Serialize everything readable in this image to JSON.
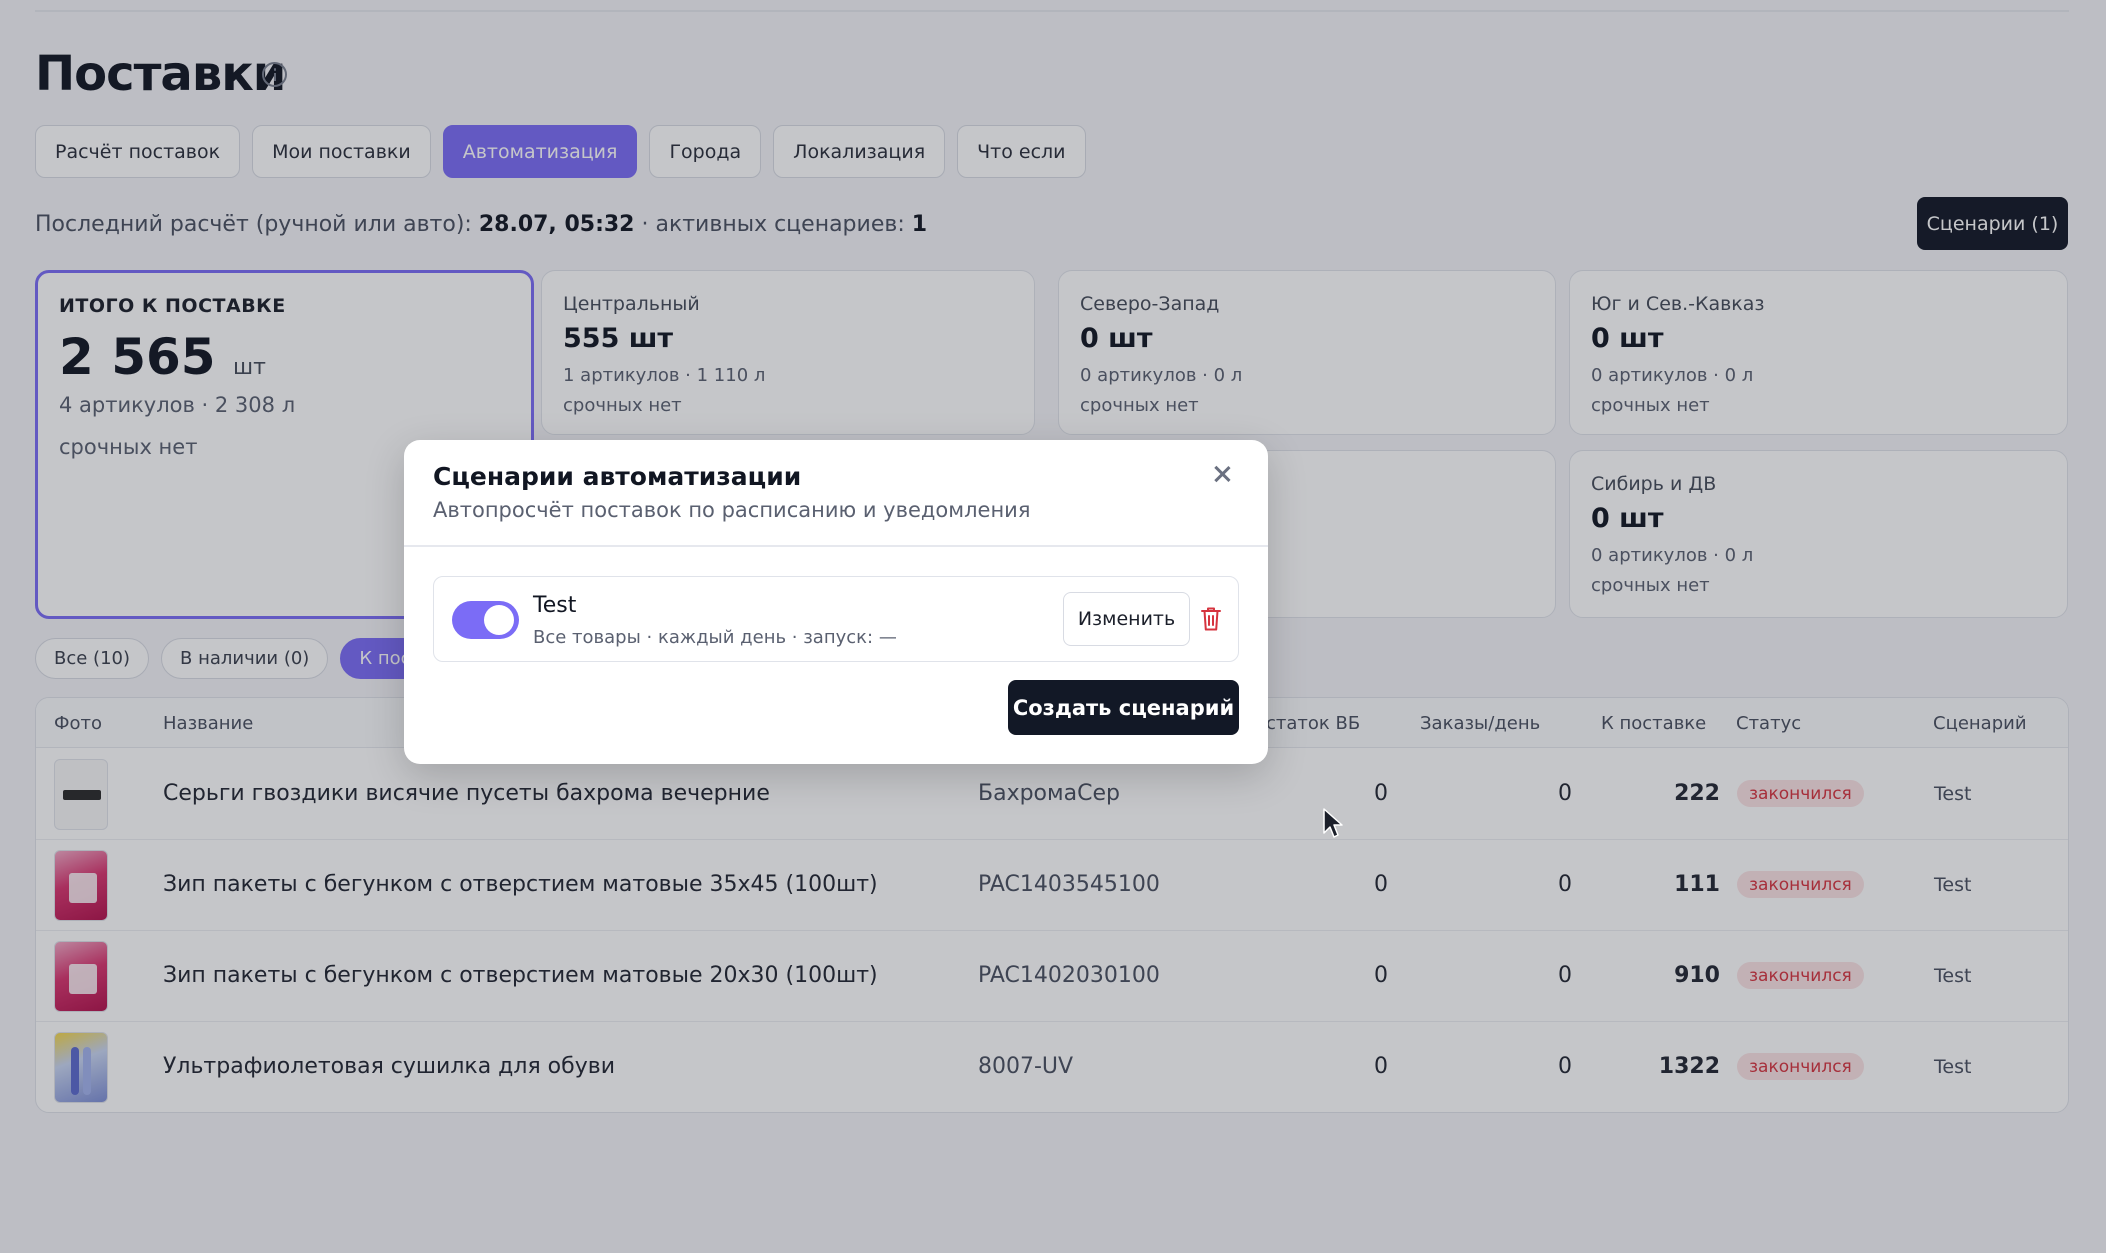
{
  "page": {
    "title": "Поставки",
    "tabs": [
      "Расчёт поставок",
      "Мои поставки",
      "Автоматизация",
      "Города",
      "Локализация",
      "Что если"
    ],
    "active_tab": "Автоматизация",
    "last_calc_prefix": "Последний расчёт (ручной или авто):",
    "last_calc_time": "28.07, 05:32",
    "active_scenarios_label": "· активных сценариев:",
    "active_scenarios_count": "1",
    "scenarios_button": "Сценарии (1)"
  },
  "total_card": {
    "title": "ИТОГО К ПОСТАВКЕ",
    "value": "2 565",
    "unit": "шт",
    "sub": "4 артикулов · 2 308 л",
    "urgent": "срочных нет"
  },
  "regions": [
    {
      "title": "Центральный",
      "value": "555 шт",
      "sub": "1 артикулов · 1 110 л",
      "urgent": "срочных нет"
    },
    {
      "title": "Северо-Запад",
      "value": "0 шт",
      "sub": "0 артикулов · 0 л",
      "urgent": "срочных нет"
    },
    {
      "title": "Юг и Сев.-Кавказ",
      "value": "0 шт",
      "sub": "0 артикулов · 0 л",
      "urgent": "срочных нет"
    },
    {
      "title": "Сибирь и ДВ",
      "value": "0 шт",
      "sub": "0 артикулов · 0 л",
      "urgent": "срочных нет"
    }
  ],
  "filters": [
    "Все (10)",
    "В наличии (0)",
    "К поста"
  ],
  "table": {
    "headers": {
      "photo": "Фото",
      "name": "Название",
      "stock": "статок ВБ",
      "orders": "Заказы/день",
      "to_supply": "К поставке",
      "status": "Статус",
      "scenario": "Сценарий"
    },
    "rows": [
      {
        "name": "Серьги гвоздики висячие пусеты бахрома вечерние",
        "sku": "БахромаСер",
        "stock": "0",
        "orders": "0",
        "to_supply": "222",
        "status": "закончился",
        "scenario": "Test"
      },
      {
        "name": "Зип пакеты с бегунком с отверстием матовые 35х45 (100шт)",
        "sku": "PAC1403545100",
        "stock": "0",
        "orders": "0",
        "to_supply": "111",
        "status": "закончился",
        "scenario": "Test"
      },
      {
        "name": "Зип пакеты с бегунком с отверстием матовые 20х30 (100шт)",
        "sku": "PAC1402030100",
        "stock": "0",
        "orders": "0",
        "to_supply": "910",
        "status": "закончился",
        "scenario": "Test"
      },
      {
        "name": "Ультрафиолетовая сушилка для обуви",
        "sku": "8007-UV",
        "stock": "0",
        "orders": "0",
        "to_supply": "1322",
        "status": "закончился",
        "scenario": "Test"
      }
    ]
  },
  "modal": {
    "title": "Сценарии автоматизации",
    "subtitle": "Автопросчёт поставок по расписанию и уведомления",
    "scenario": {
      "name": "Test",
      "meta": "Все товары · каждый день · запуск: —",
      "enabled": true
    },
    "edit_button": "Изменить",
    "create_button": "Создать сценарий"
  },
  "colors": {
    "accent": "#7b6cf6",
    "dark_button": "#121826",
    "danger": "#d6343f"
  }
}
